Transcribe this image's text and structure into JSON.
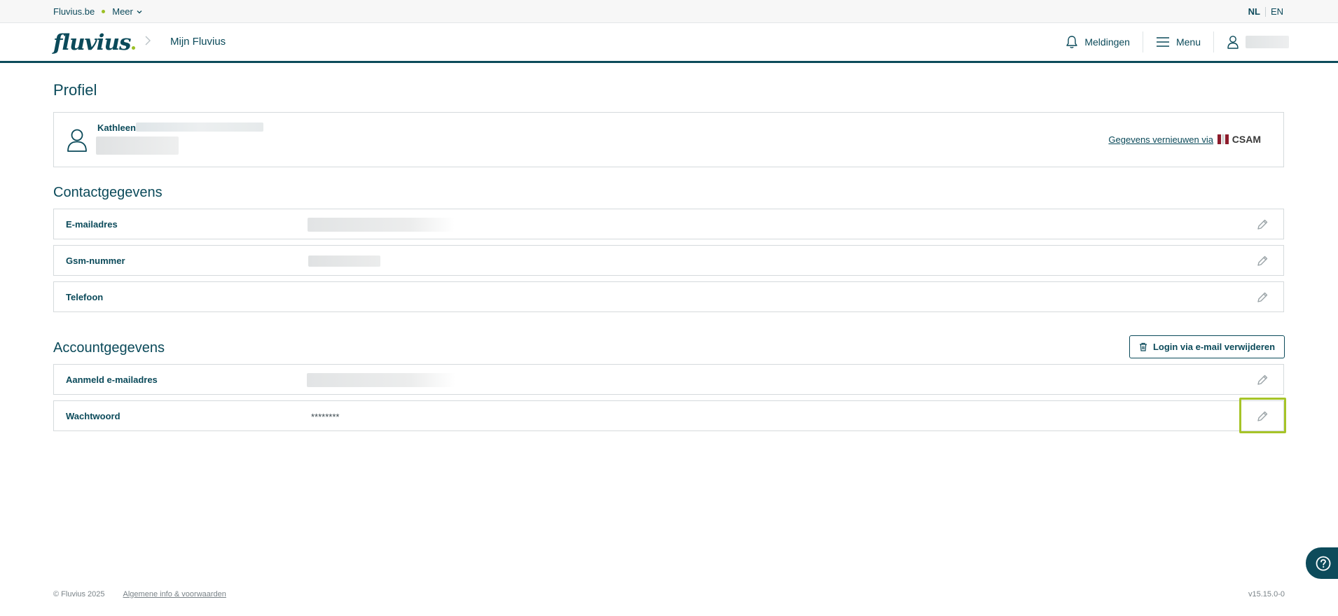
{
  "topbar": {
    "site_link": "Fluvius.be",
    "more_label": "Meer",
    "languages": [
      "NL",
      "EN"
    ],
    "active_language": "NL"
  },
  "header": {
    "logo_text": "fluvius",
    "breadcrumb": "Mijn Fluvius",
    "notifications_label": "Meldingen",
    "menu_label": "Menu"
  },
  "profile": {
    "title": "Profiel",
    "first_name": "Kathleen",
    "renew_link": "Gegevens vernieuwen via",
    "provider": "CSAM"
  },
  "contact": {
    "title": "Contactgegevens",
    "rows": [
      {
        "label": "E-mailadres",
        "value": ""
      },
      {
        "label": "Gsm-nummer",
        "value": ""
      },
      {
        "label": "Telefoon",
        "value": ""
      }
    ]
  },
  "account": {
    "title": "Accountgegevens",
    "delete_button": "Login via e-mail verwijderen",
    "rows": [
      {
        "label": "Aanmeld e-mailadres",
        "value": ""
      },
      {
        "label": "Wachtwoord",
        "value": "********"
      }
    ]
  },
  "footer": {
    "copyright": "© Fluvius 2025",
    "terms_link": "Algemene info & voorwaarden",
    "version": "v15.15.0-0"
  },
  "colors": {
    "brand": "#0b4a5a",
    "accent": "#9bbf24",
    "focus": "#a6c428"
  }
}
